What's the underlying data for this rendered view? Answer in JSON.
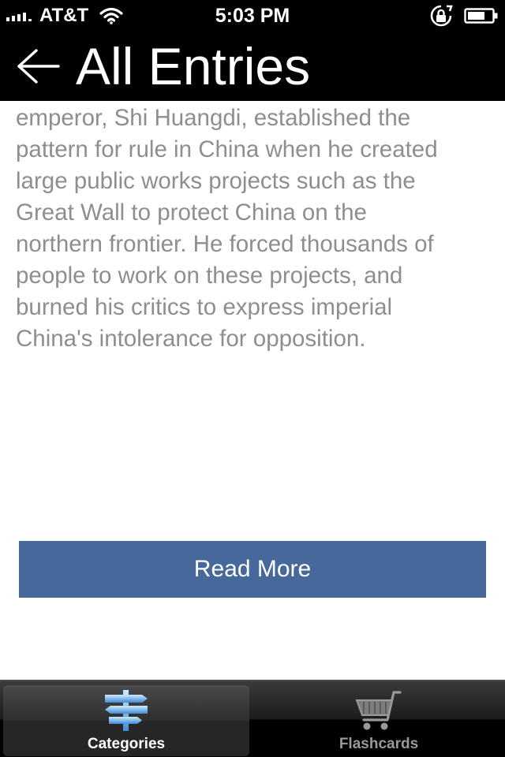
{
  "status_bar": {
    "carrier": "AT&T",
    "time": "5:03 PM",
    "icons": [
      "signal-icon",
      "wifi-icon",
      "rotation-lock-icon",
      "battery-icon"
    ]
  },
  "nav": {
    "title": "All Entries",
    "back_icon": "left-arrow-icon"
  },
  "entry": {
    "text": "emperor, Shi Huangdi, established the\npattern for rule in China when he created\nlarge public works projects such as the\nGreat Wall to protect China on the\nnorthern frontier. He forced thousands of\npeople to work on these projects, and\nburned his critics to express imperial\nChina's intolerance for opposition."
  },
  "read_more": {
    "label": "Read More"
  },
  "tab_bar": {
    "tabs": [
      {
        "label": "Categories",
        "icon": "signpost-icon",
        "selected": true
      },
      {
        "label": "Flashcards",
        "icon": "shopping-cart-icon",
        "selected": false
      }
    ]
  },
  "colors": {
    "header_bg": "#000000",
    "body_text": "#8e8e8e",
    "button_bg": "#46689a",
    "button_text": "#ffffff",
    "tab_active_label": "#ffffff",
    "tab_inactive_label": "#9a9a9a",
    "tab_active_icon": "#5aa9e6"
  }
}
